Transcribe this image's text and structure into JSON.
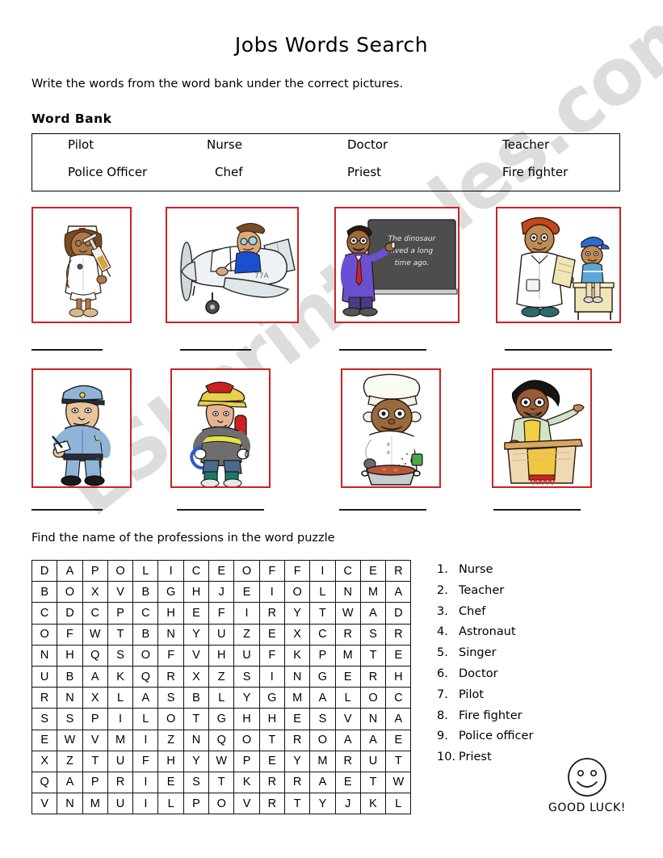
{
  "page": {
    "title": "Jobs Words Search",
    "instruction": "Write the words from the word bank under the correct pictures.",
    "wordbank_heading": "Word Bank",
    "find_text": "Find the name of the professions in the word puzzle"
  },
  "word_bank": {
    "row1": [
      "Pilot",
      "Nurse",
      "Doctor",
      "Teacher"
    ],
    "row2": [
      "Police Officer",
      "Chef",
      "Priest",
      "Fire fighter"
    ]
  },
  "pictures": {
    "border_color": "#cc2222",
    "row1": [
      {
        "name": "nurse-picture",
        "alt": "Nurse holding a syringe"
      },
      {
        "name": "pilot-picture",
        "alt": "Pilot flying a small airplane"
      },
      {
        "name": "teacher-picture",
        "alt": "Teacher at a blackboard",
        "blackboard_text": "The dinosaur lived a long time ago."
      },
      {
        "name": "doctor-picture",
        "alt": "Doctor with a child patient"
      }
    ],
    "row2": [
      {
        "name": "police-officer-picture",
        "alt": "Police officer writing a ticket"
      },
      {
        "name": "fire-fighter-picture",
        "alt": "Fire fighter holding a hose"
      },
      {
        "name": "chef-picture",
        "alt": "Chef cooking a pot of stew"
      },
      {
        "name": "priest-picture",
        "alt": "Priest preaching at a pulpit"
      }
    ]
  },
  "puzzle": {
    "columns": 15,
    "rows": 12,
    "grid": [
      [
        "D",
        "A",
        "P",
        "O",
        "L",
        "I",
        "C",
        "E",
        "O",
        "F",
        "F",
        "I",
        "C",
        "E",
        "R"
      ],
      [
        "B",
        "O",
        "X",
        "V",
        "B",
        "G",
        "H",
        "J",
        "E",
        "I",
        "O",
        "L",
        "N",
        "M",
        "A"
      ],
      [
        "C",
        "D",
        "C",
        "P",
        "C",
        "H",
        "E",
        "F",
        "I",
        "R",
        "Y",
        "T",
        "W",
        "A",
        "D"
      ],
      [
        "O",
        "F",
        "W",
        "T",
        "B",
        "N",
        "Y",
        "U",
        "Z",
        "E",
        "X",
        "C",
        "R",
        "S",
        "R"
      ],
      [
        "N",
        "H",
        "Q",
        "S",
        "O",
        "F",
        "V",
        "H",
        "U",
        "F",
        "K",
        "P",
        "M",
        "T",
        "E"
      ],
      [
        "U",
        "B",
        "A",
        "K",
        "Q",
        "R",
        "X",
        "Z",
        "S",
        "I",
        "N",
        "G",
        "E",
        "R",
        "H"
      ],
      [
        "R",
        "N",
        "X",
        "L",
        "A",
        "S",
        "B",
        "L",
        "Y",
        "G",
        "M",
        "A",
        "L",
        "O",
        "C"
      ],
      [
        "S",
        "S",
        "P",
        "I",
        "L",
        "O",
        "T",
        "G",
        "H",
        "H",
        "E",
        "S",
        "V",
        "N",
        "A"
      ],
      [
        "E",
        "W",
        "V",
        "M",
        "I",
        "Z",
        "N",
        "Q",
        "O",
        "T",
        "R",
        "O",
        "A",
        "A",
        "E"
      ],
      [
        "X",
        "Z",
        "T",
        "U",
        "F",
        "H",
        "Y",
        "W",
        "P",
        "E",
        "Y",
        "M",
        "R",
        "U",
        "T"
      ],
      [
        "Q",
        "A",
        "P",
        "R",
        "I",
        "E",
        "S",
        "T",
        "K",
        "R",
        "R",
        "A",
        "E",
        "T",
        "W"
      ],
      [
        "V",
        "N",
        "M",
        "U",
        "I",
        "L",
        "P",
        "O",
        "V",
        "R",
        "T",
        "Y",
        "J",
        "K",
        "L"
      ]
    ]
  },
  "professions": [
    {
      "num": "1.",
      "label": "Nurse"
    },
    {
      "num": "2.",
      "label": "Teacher"
    },
    {
      "num": "3.",
      "label": "Chef"
    },
    {
      "num": "4.",
      "label": "Astronaut"
    },
    {
      "num": "5.",
      "label": "Singer"
    },
    {
      "num": "6.",
      "label": "Doctor"
    },
    {
      "num": "7.",
      "label": "Pilot"
    },
    {
      "num": "8.",
      "label": "Fire fighter"
    },
    {
      "num": "9.",
      "label": "Police officer"
    },
    {
      "num": "10.",
      "label": "Priest"
    }
  ],
  "good_luck": {
    "text": "GOOD LUCK!",
    "icon": "smiley-face-icon"
  },
  "watermark": {
    "text": "ESLprintables.com",
    "color": "#c9c9c9"
  }
}
